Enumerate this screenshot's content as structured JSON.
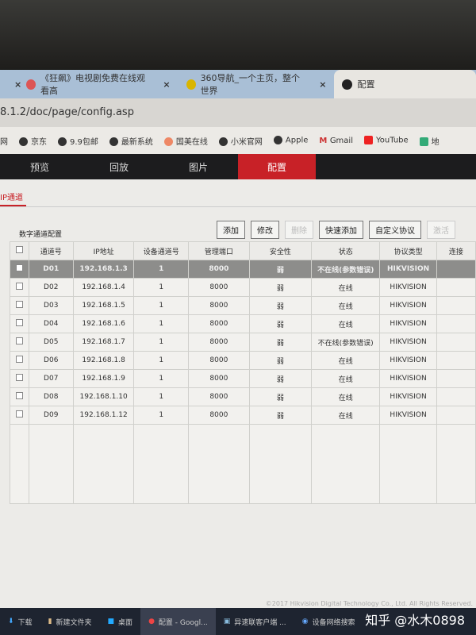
{
  "browser": {
    "tabs": [
      {
        "label": "《狂飙》电视剧免费在线观看高"
      },
      {
        "label": "360导航_一个主页，整个世界"
      },
      {
        "label": "配置",
        "active": true
      }
    ],
    "url": "8.1.2/doc/page/config.asp",
    "bookmarks": [
      "网",
      "京东",
      "9.9包邮",
      "最新系统",
      "国美在线",
      "小米官网",
      "Apple",
      "Gmail",
      "YouTube",
      "地"
    ]
  },
  "nav": {
    "items": [
      "预览",
      "回放",
      "图片",
      "配置"
    ],
    "active": "配置"
  },
  "subtab": "IP通道",
  "panel": {
    "title": "数字通道配置",
    "buttons": [
      {
        "label": "添加"
      },
      {
        "label": "修改"
      },
      {
        "label": "删除",
        "disabled": true
      },
      {
        "label": "快速添加"
      },
      {
        "label": "自定义协议"
      },
      {
        "label": "激活",
        "disabled": true
      }
    ]
  },
  "table": {
    "columns": [
      "",
      "通道号",
      "IP地址",
      "设备通道号",
      "管理端口",
      "安全性",
      "状态",
      "协议类型",
      "连接"
    ],
    "rows": [
      [
        "D01",
        "192.168.1.3",
        "1",
        "8000",
        "弱",
        "不在线(参数错误)",
        "HIKVISION"
      ],
      [
        "D02",
        "192.168.1.4",
        "1",
        "8000",
        "弱",
        "在线",
        "HIKVISION"
      ],
      [
        "D03",
        "192.168.1.5",
        "1",
        "8000",
        "弱",
        "在线",
        "HIKVISION"
      ],
      [
        "D04",
        "192.168.1.6",
        "1",
        "8000",
        "弱",
        "在线",
        "HIKVISION"
      ],
      [
        "D05",
        "192.168.1.7",
        "1",
        "8000",
        "弱",
        "不在线(参数错误)",
        "HIKVISION"
      ],
      [
        "D06",
        "192.168.1.8",
        "1",
        "8000",
        "弱",
        "在线",
        "HIKVISION"
      ],
      [
        "D07",
        "192.168.1.9",
        "1",
        "8000",
        "弱",
        "在线",
        "HIKVISION"
      ],
      [
        "D08",
        "192.168.1.10",
        "1",
        "8000",
        "弱",
        "在线",
        "HIKVISION"
      ],
      [
        "D09",
        "192.168.1.12",
        "1",
        "8000",
        "弱",
        "在线",
        "HIKVISION"
      ]
    ],
    "selected_row": 0
  },
  "copyright": "©2017 Hikvision Digital Technology Co., Ltd. All Rights Reserved.",
  "taskbar": [
    "下载",
    "新建文件夹",
    "桌面",
    "配置 - Googl...",
    "异速联客户端 ...",
    "设备网络搜索"
  ],
  "watermark": "知乎 @水木0898",
  "colors": {
    "accent": "#c82127",
    "nav_bg": "#1c1c1e"
  }
}
